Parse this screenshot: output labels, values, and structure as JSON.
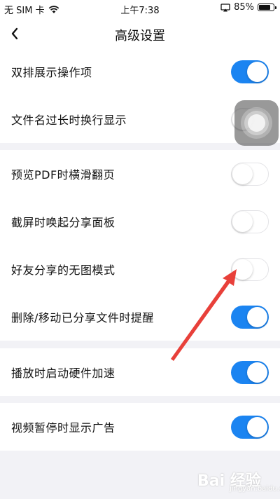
{
  "status_bar": {
    "carrier": "无 SIM 卡",
    "time": "上午7:38",
    "battery": "85%",
    "battery_level": 0.85
  },
  "nav": {
    "title": "高级设置"
  },
  "settings": [
    {
      "label": "双排展示操作项",
      "on": true
    },
    {
      "label": "文件名过长时换行显示",
      "on": false
    },
    {
      "label": "预览PDF时横滑翻页",
      "on": false
    },
    {
      "label": "截屏时唤起分享面板",
      "on": false
    },
    {
      "label": "好友分享的无图模式",
      "on": false
    },
    {
      "label": "删除/移动已分享文件时提醒",
      "on": true
    },
    {
      "label": "播放时启动硬件加速",
      "on": true
    },
    {
      "label": "视频暂停时显示广告",
      "on": true
    }
  ],
  "colors": {
    "toggle_on": "#1b84f1",
    "arrow": "#e8403a"
  },
  "watermark": {
    "text": "Bai 经验",
    "sub": "jingyan.baidu.com"
  }
}
